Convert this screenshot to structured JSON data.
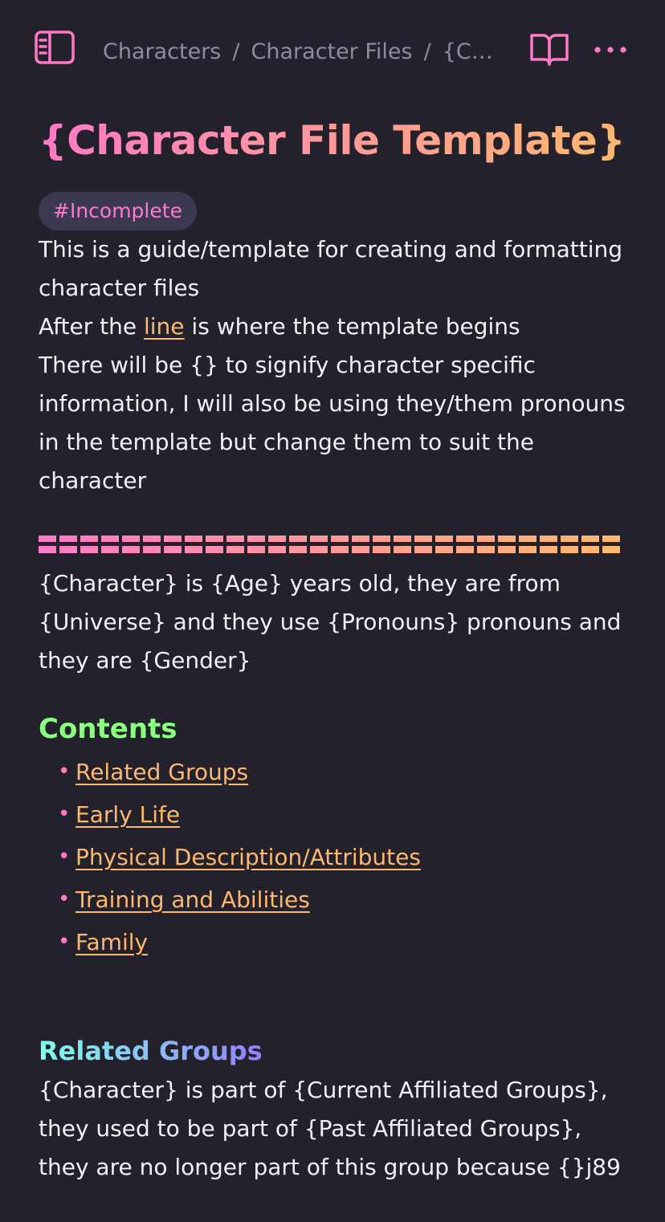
{
  "topbar": {
    "breadcrumb": [
      "Characters",
      "Character Files",
      "{Cha…"
    ],
    "separator": "/",
    "icons": {
      "sidebar": "sidebar-toggle-icon",
      "reading": "open-book-icon",
      "more": "more-horizontal-icon"
    },
    "accent": "#ff79c6"
  },
  "note": {
    "title": "{Character File Template}",
    "tag": "#Incomplete",
    "intro_line1": "This is a guide/template for creating and formatting character files",
    "intro_line2_before": "After the ",
    "intro_line2_link": "line",
    "intro_line2_after": " is where the template begins",
    "intro_line3": "There will be {} to signify character specific information, I will also be using they/them pronouns in the template but change them to suit the character",
    "divider": "==========================",
    "summary": "{Character} is {Age} years old, they are from {Universe} and they use {Pronouns} pronouns and they are {Gender}",
    "contents_heading": "Contents",
    "contents": [
      "Related Groups",
      "Early Life",
      "Physical Description/Attributes",
      "Training and Abilities",
      "Family"
    ],
    "related_heading": "Related Groups",
    "related_text": "{Character} is part of {Current Affiliated Groups}, they used to be part of {Past Affiliated Groups}, they are no longer part of this group because {}j89"
  },
  "colors": {
    "background": "#22212c",
    "text": "#f2f2f5",
    "muted": "#8e8ca0",
    "pink": "#ff79c6",
    "orange": "#ffb86c",
    "green": "#8aff80",
    "cyan": "#80ffea",
    "purple": "#9580ff",
    "tag_bg": "#3b3952"
  }
}
